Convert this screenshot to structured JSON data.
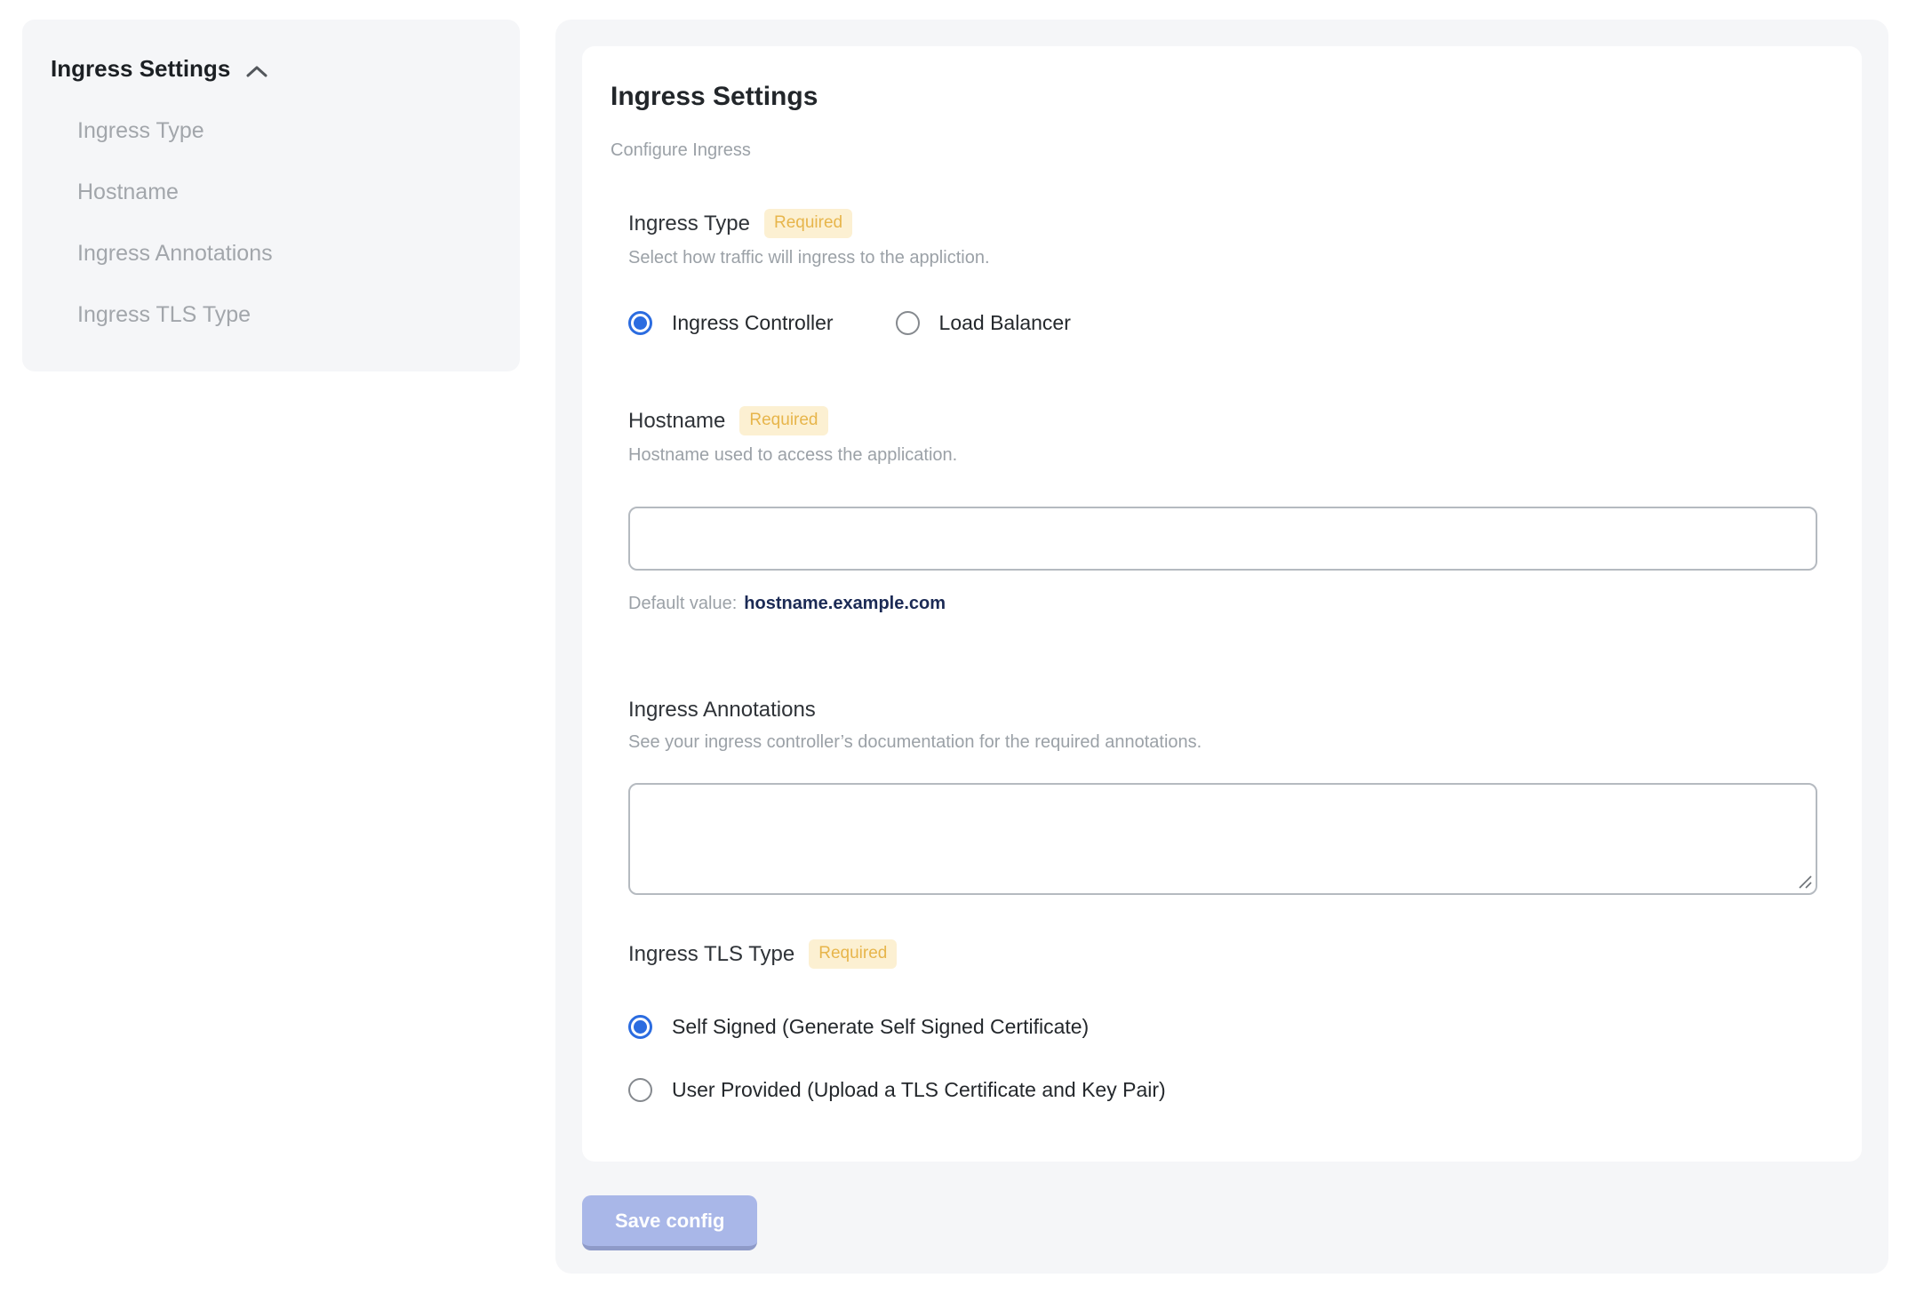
{
  "colors": {
    "accent_blue": "#2b6ce0",
    "badge_bg": "#fcf0d2",
    "badge_text": "#e7b54b",
    "default_value_navy": "#1b2a55",
    "save_button_bg": "#a9b7e8",
    "save_button_edge": "#8e9ac8",
    "panel_bg": "#f5f6f8"
  },
  "sidebar": {
    "title": "Ingress Settings",
    "collapse_icon": "chevron-up-icon",
    "items": [
      {
        "label": "Ingress Type"
      },
      {
        "label": "Hostname"
      },
      {
        "label": "Ingress Annotations"
      },
      {
        "label": "Ingress TLS Type"
      }
    ]
  },
  "panel": {
    "title": "Ingress Settings",
    "subtitle": "Configure Ingress",
    "required_label": "Required",
    "sections": {
      "ingress_type": {
        "label": "Ingress Type",
        "required": true,
        "description": "Select how traffic will ingress to the appliction.",
        "options": [
          {
            "label": "Ingress Controller",
            "selected": true
          },
          {
            "label": "Load Balancer",
            "selected": false
          }
        ]
      },
      "hostname": {
        "label": "Hostname",
        "required": true,
        "description": "Hostname used to access the application.",
        "value": "",
        "default_prefix": "Default value:",
        "default_value": "hostname.example.com"
      },
      "annotations": {
        "label": "Ingress Annotations",
        "required": false,
        "description": "See your ingress controller’s documentation for the required annotations.",
        "value": ""
      },
      "tls": {
        "label": "Ingress TLS Type",
        "required": true,
        "options": [
          {
            "label": "Self Signed (Generate Self Signed Certificate)",
            "selected": true
          },
          {
            "label": "User Provided (Upload a TLS Certificate and Key Pair)",
            "selected": false
          }
        ]
      }
    },
    "save_button_label": "Save config"
  }
}
